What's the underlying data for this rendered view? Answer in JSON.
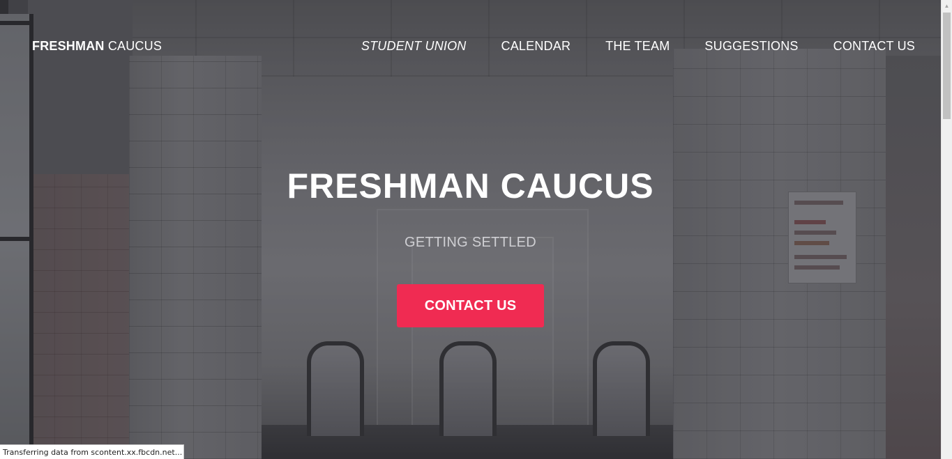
{
  "navbar": {
    "brand_bold": "FRESHMAN",
    "brand_light": "CAUCUS",
    "links": [
      {
        "label": "STUDENT UNION",
        "active": true
      },
      {
        "label": "CALENDAR",
        "active": false
      },
      {
        "label": "THE TEAM",
        "active": false
      },
      {
        "label": "SUGGESTIONS",
        "active": false
      },
      {
        "label": "CONTACT US",
        "active": false
      }
    ]
  },
  "hero": {
    "title": "FRESHMAN CAUCUS",
    "subtitle": "GETTING SETTLED",
    "button_label": "CONTACT US",
    "button_color": "#f02b52",
    "background_image": "hallway-escalators-photo"
  },
  "status_bar": {
    "text": "Transferring data from scontent.xx.fbcdn.net..."
  },
  "scrollbar": {
    "up_icon": "triangle-up-icon"
  }
}
